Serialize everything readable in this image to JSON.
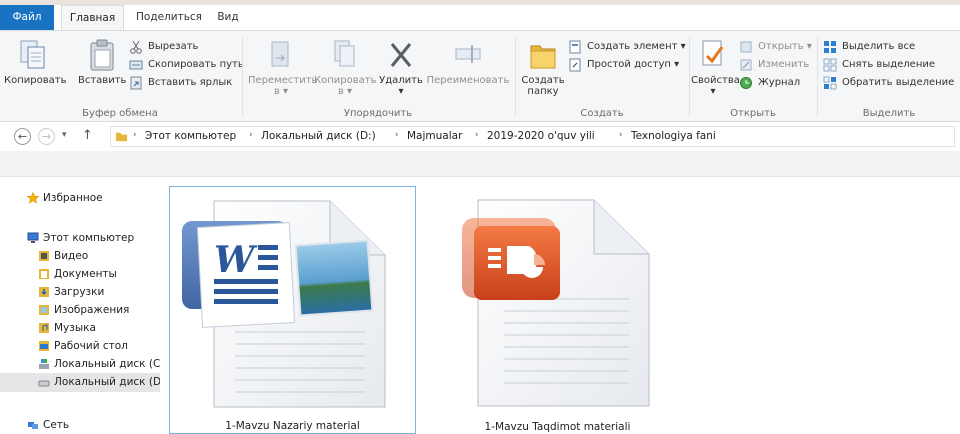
{
  "tabs": {
    "file": "Файл",
    "home": "Главная",
    "share": "Поделиться",
    "view": "Вид"
  },
  "ribbon": {
    "clipboard": {
      "label": "Буфер обмена",
      "copy": "Копировать",
      "paste": "Вставить",
      "cut": "Вырезать",
      "copy_path": "Скопировать путь",
      "paste_shortcut": "Вставить ярлык"
    },
    "organize": {
      "label": "Упорядочить",
      "move_to_1": "Переместить",
      "move_to_2": "в ▾",
      "copy_to_1": "Копировать",
      "copy_to_2": "в ▾",
      "delete_1": "Удалить",
      "delete_2": "▾",
      "rename": "Переименовать"
    },
    "new": {
      "label": "Создать",
      "new_folder_1": "Создать",
      "new_folder_2": "папку",
      "new_item": "Создать элемент ▾",
      "easy_access": "Простой доступ ▾"
    },
    "open": {
      "label": "Открыть",
      "properties": "Свойства",
      "properties_arrow": "▾",
      "open": "Открыть ▾",
      "edit": "Изменить",
      "history": "Журнал"
    },
    "select": {
      "label": "Выделить",
      "select_all": "Выделить все",
      "select_none": "Снять выделение",
      "invert": "Обратить выделение"
    }
  },
  "nav_buttons": {
    "back": "←",
    "forward": "→",
    "recent": "▾",
    "up": "↑"
  },
  "breadcrumb": [
    "Этот компьютер",
    "Локальный диск (D:)",
    "Majmualar",
    "2019-2020 o'quv yili",
    "Texnologiya fani"
  ],
  "sidebar": {
    "favorites": "Избранное",
    "this_pc": "Этот компьютер",
    "items": [
      {
        "label": "Видео",
        "icon": "video-folder-icon"
      },
      {
        "label": "Документы",
        "icon": "documents-folder-icon"
      },
      {
        "label": "Загрузки",
        "icon": "downloads-folder-icon"
      },
      {
        "label": "Изображения",
        "icon": "pictures-folder-icon"
      },
      {
        "label": "Музыка",
        "icon": "music-folder-icon"
      },
      {
        "label": "Рабочий стол",
        "icon": "desktop-folder-icon"
      },
      {
        "label": "Локальный диск (C",
        "icon": "system-drive-icon"
      },
      {
        "label": "Локальный диск (D",
        "icon": "drive-icon"
      }
    ],
    "network": "Сеть"
  },
  "files": [
    {
      "name": "1-Mavzu Nazariy material",
      "type": "word-document-icon"
    },
    {
      "name": "1-Mavzu Taqdimot materiali",
      "type": "powerpoint-document-icon"
    }
  ],
  "colors": {
    "file_tab": "#1a73c2",
    "selection_border": "#7ab3e6",
    "word": "#2b579a",
    "powerpoint": "#d24726"
  }
}
